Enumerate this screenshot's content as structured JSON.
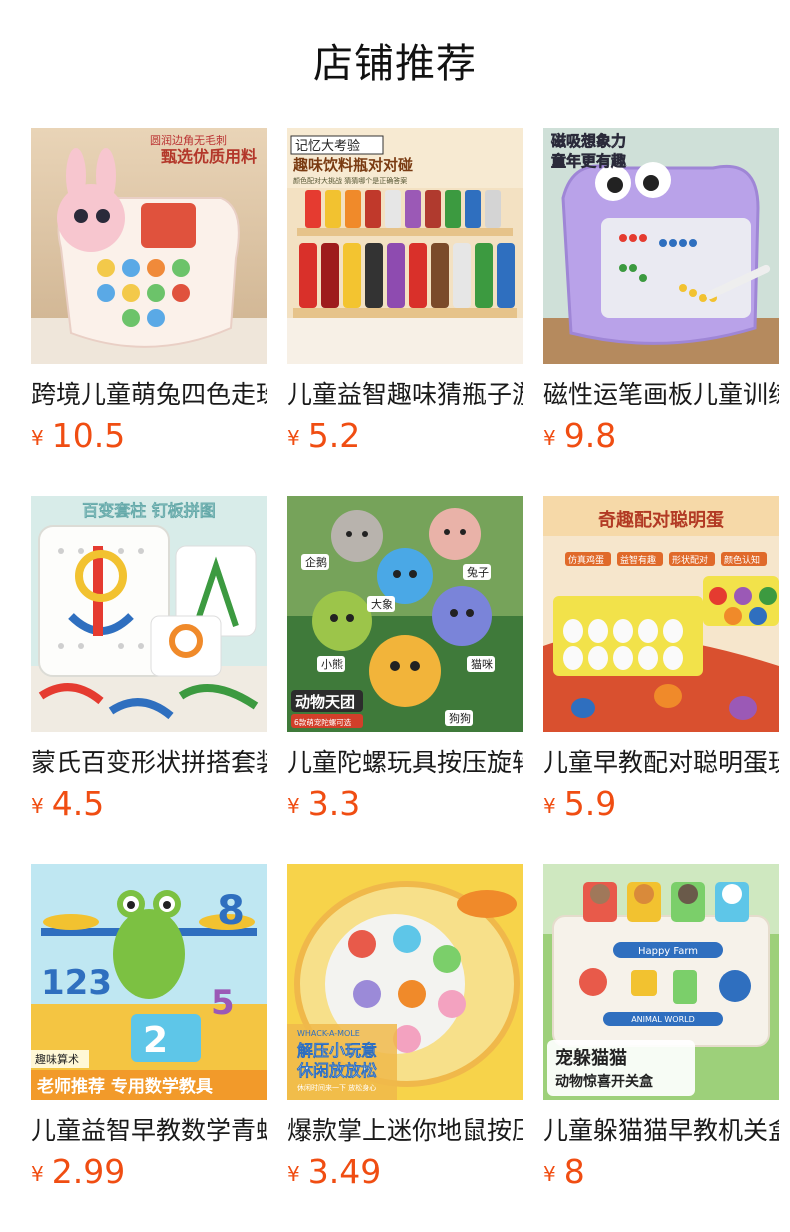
{
  "page": {
    "title": "店铺推荐"
  },
  "products": [
    {
      "name": "跨境儿童萌兔四色走珠",
      "currency": "¥",
      "price": "10.5",
      "image_text": [
        "圆润边角无毛刺",
        "甄选优质用料"
      ],
      "accent": "#f3a9b7"
    },
    {
      "name": "儿童益智趣味猜瓶子游戏",
      "currency": "¥",
      "price": "5.2",
      "image_text": [
        "记忆大考验",
        "趣味饮料瓶对对碰",
        "颜色配对大挑战 猜猜哪个是正确答案"
      ],
      "accent": "#e8b24a"
    },
    {
      "name": "磁性运笔画板儿童训练",
      "currency": "¥",
      "price": "9.8",
      "image_text": [
        "磁吸想象力",
        "童年更有趣"
      ],
      "accent": "#b79ae8"
    },
    {
      "name": "蒙氏百变形状拼搭套装",
      "currency": "¥",
      "price": "4.5",
      "image_text": [
        "百变套柱 钉板拼图"
      ],
      "accent": "#7ec8d8"
    },
    {
      "name": "儿童陀螺玩具按压旋转",
      "currency": "¥",
      "price": "3.3",
      "image_text": [
        "动物天团",
        "6款萌宠陀螺可选",
        "企鹅",
        "兔子",
        "大象",
        "小熊",
        "猫咪",
        "狗狗"
      ],
      "accent": "#6fae4f"
    },
    {
      "name": "儿童早教配对聪明蛋玩具",
      "currency": "¥",
      "price": "5.9",
      "image_text": [
        "奇趣配对聪明蛋",
        "仿真鸡蛋",
        "益智有趣",
        "形状配对",
        "颜色认知"
      ],
      "accent": "#f0a44a"
    },
    {
      "name": "儿童益智早教数学青蛙天平",
      "currency": "¥",
      "price": "2.99",
      "image_text": [
        "趣味算术",
        "老师推荐 专用数学教具"
      ],
      "accent": "#5bb85c"
    },
    {
      "name": "爆款掌上迷你地鼠按压",
      "currency": "¥",
      "price": "3.49",
      "image_text": [
        "WHACK-A-MOLE",
        "解压小玩意",
        "休闲放放松",
        "休闲时间来一下 放松身心"
      ],
      "accent": "#f5c842"
    },
    {
      "name": "儿童躲猫猫早教机关盒",
      "currency": "¥",
      "price": "8",
      "image_text": [
        "Happy Farm",
        "ANIMAL WORLD",
        "宠躲猫猫",
        "动物惊喜开关盒"
      ],
      "accent": "#7bc96f"
    }
  ]
}
